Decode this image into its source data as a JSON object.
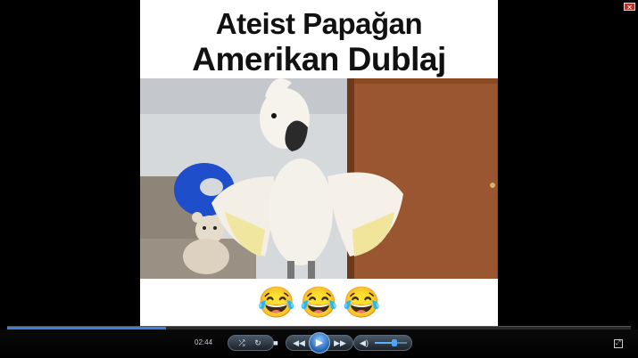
{
  "video": {
    "title_line1": "Ateist Papağan",
    "title_line2": "Amerikan Dublaj",
    "emoji": [
      "😂",
      "😂",
      "😂"
    ]
  },
  "player": {
    "elapsed": "02:44",
    "progress": 0.254,
    "volume": 0.6,
    "accent_color": "#3d7ce0"
  },
  "icons": {
    "close": "close-icon",
    "shuffle": "shuffle-icon",
    "repeat": "repeat-icon",
    "stop": "stop-icon",
    "previous": "rewind-icon",
    "play": "play-icon",
    "next": "fast-forward-icon",
    "volume": "speaker-icon",
    "fullscreen": "fullscreen-icon"
  }
}
